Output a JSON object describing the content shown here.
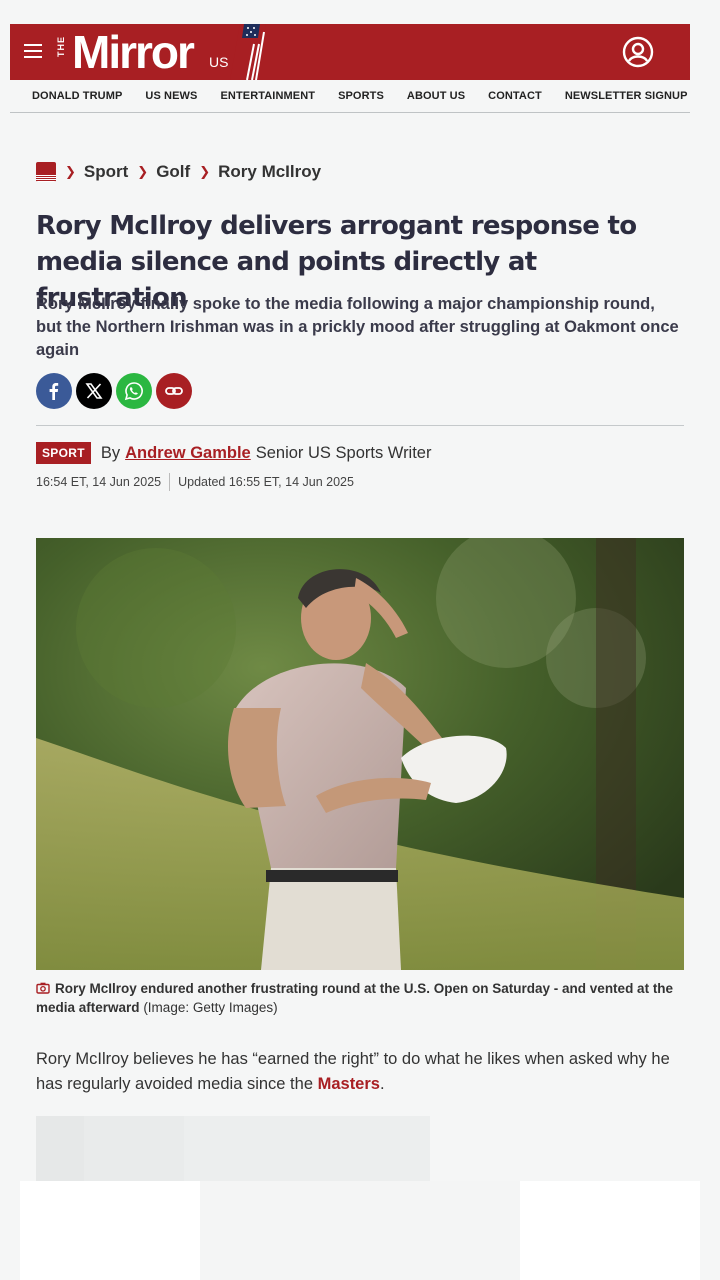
{
  "header": {
    "logo_the": "THE",
    "logo_word": "Mirror",
    "logo_us": "US"
  },
  "nav": {
    "items": [
      "DONALD TRUMP",
      "US NEWS",
      "ENTERTAINMENT",
      "SPORTS",
      "ABOUT US",
      "CONTACT",
      "NEWSLETTER SIGNUP"
    ]
  },
  "breadcrumb": {
    "items": [
      "Sport",
      "Golf",
      "Rory McIlroy"
    ]
  },
  "article": {
    "headline": "Rory McIlroy delivers arrogant response to media silence and points directly at frustration",
    "standfirst": "Rory McIlroy finally spoke to the media following a major championship round, but the Northern Irishman was in a prickly mood after struggling at Oakmont once again",
    "tag": "SPORT",
    "by": "By",
    "author": "Andrew Gamble",
    "role": "Senior US Sports Writer",
    "published": "16:54 ET, 14 Jun 2025",
    "updated": "Updated 16:55 ET, 14 Jun 2025",
    "caption_bold": "Rory McIlroy endured another frustrating round at the U.S. Open on Saturday - and vented at the media afterward",
    "caption_credit": "(Image: Getty Images)",
    "body_before": "Rory McIlroy believes he has “earned the right” to do what he likes when asked why he has regularly avoided media since the ",
    "body_link": "Masters",
    "body_after": "."
  },
  "share": {
    "icons": [
      "facebook-icon",
      "x-icon",
      "whatsapp-icon",
      "copy-link-icon"
    ]
  },
  "colors": {
    "brand": "#a81f23",
    "text": "#2d2d40",
    "background": "#f5f6f6"
  }
}
